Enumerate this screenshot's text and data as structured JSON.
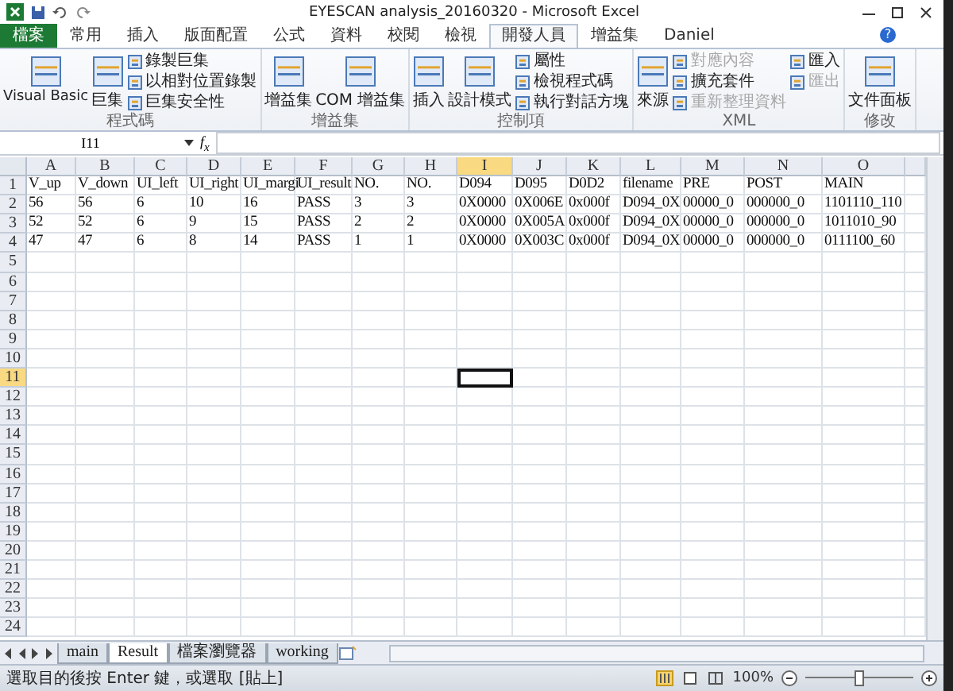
{
  "title_bar": {
    "title": "EYESCAN analysis_20160320 - Microsoft Excel"
  },
  "ribbon_tabs": [
    {
      "label": "檔案",
      "kind": "file",
      "selected": false
    },
    {
      "label": "常用",
      "kind": "tab",
      "selected": false
    },
    {
      "label": "插入",
      "kind": "tab",
      "selected": false
    },
    {
      "label": "版面配置",
      "kind": "tab",
      "selected": false
    },
    {
      "label": "公式",
      "kind": "tab",
      "selected": false
    },
    {
      "label": "資料",
      "kind": "tab",
      "selected": false
    },
    {
      "label": "校閱",
      "kind": "tab",
      "selected": false
    },
    {
      "label": "檢視",
      "kind": "tab",
      "selected": false
    },
    {
      "label": "開發人員",
      "kind": "tab",
      "selected": true
    },
    {
      "label": "增益集",
      "kind": "tab",
      "selected": false
    },
    {
      "label": "Daniel",
      "kind": "tab",
      "selected": false
    }
  ],
  "help_glyph": "?",
  "ribbon_groups": [
    {
      "label": "程式碼",
      "large": [
        "Visual Basic",
        "巨集"
      ],
      "small": [
        {
          "label": "錄製巨集",
          "disabled": false
        },
        {
          "label": "以相對位置錄製",
          "disabled": false
        },
        {
          "label": "巨集安全性",
          "disabled": false
        }
      ]
    },
    {
      "label": "增益集",
      "large": [
        "增益集",
        "COM 增益集"
      ]
    },
    {
      "label": "控制項",
      "large": [
        "插入",
        "設計模式"
      ],
      "small": [
        {
          "label": "屬性",
          "disabled": false
        },
        {
          "label": "檢視程式碼",
          "disabled": false
        },
        {
          "label": "執行對話方塊",
          "disabled": false
        }
      ]
    },
    {
      "label": "XML",
      "large": [
        "來源"
      ],
      "small": [
        {
          "label": "對應內容",
          "disabled": true
        },
        {
          "label": "擴充套件",
          "disabled": false
        },
        {
          "label": "重新整理資料",
          "disabled": true
        },
        {
          "label": "匯入",
          "disabled": false
        },
        {
          "label": "匯出",
          "disabled": true
        }
      ]
    },
    {
      "label": "修改",
      "large": [
        "文件面板"
      ]
    }
  ],
  "formula_bar": {
    "name_box": "I11",
    "function_label": "f$_{x}$"
  },
  "sheet": {
    "columns": [
      {
        "label": "A",
        "selected": false
      },
      {
        "label": "B",
        "selected": false
      },
      {
        "label": "C",
        "selected": false
      },
      {
        "label": "D",
        "selected": false
      },
      {
        "label": "E",
        "selected": false
      },
      {
        "label": "F",
        "selected": false
      },
      {
        "label": "G",
        "selected": false
      },
      {
        "label": "H",
        "selected": false
      },
      {
        "label": "I",
        "selected": true
      },
      {
        "label": "J",
        "selected": false
      },
      {
        "label": "K",
        "selected": false
      },
      {
        "label": "L",
        "selected": false
      },
      {
        "label": "M",
        "selected": false
      },
      {
        "label": "N",
        "selected": false
      },
      {
        "label": "O",
        "selected": false
      }
    ],
    "row_numbers": [
      {
        "label": "1",
        "selected": false
      },
      {
        "label": "2",
        "selected": false
      },
      {
        "label": "3",
        "selected": false
      },
      {
        "label": "4",
        "selected": false
      },
      {
        "label": "5",
        "selected": false
      },
      {
        "label": "6",
        "selected": false
      },
      {
        "label": "7",
        "selected": false
      },
      {
        "label": "8",
        "selected": false
      },
      {
        "label": "9",
        "selected": false
      },
      {
        "label": "10",
        "selected": false
      },
      {
        "label": "11",
        "selected": true
      },
      {
        "label": "12",
        "selected": false
      },
      {
        "label": "13",
        "selected": false
      },
      {
        "label": "14",
        "selected": false
      },
      {
        "label": "15",
        "selected": false
      },
      {
        "label": "16",
        "selected": false
      },
      {
        "label": "17",
        "selected": false
      },
      {
        "label": "18",
        "selected": false
      },
      {
        "label": "19",
        "selected": false
      },
      {
        "label": "20",
        "selected": false
      },
      {
        "label": "21",
        "selected": false
      },
      {
        "label": "22",
        "selected": false
      },
      {
        "label": "23",
        "selected": false
      },
      {
        "label": "24",
        "selected": false
      }
    ],
    "rows": [
      [
        "V_up",
        "V_down",
        "UI_left",
        "UI_right",
        "UI_margi",
        "UI_result",
        "NO.",
        "NO.",
        "D094",
        "D095",
        "D0D2",
        "filename",
        "PRE",
        "POST",
        "MAIN"
      ],
      [
        "56",
        "56",
        "6",
        "10",
        "16",
        "PASS",
        "3",
        "3",
        "0X0000",
        "0X006E",
        "0x000f",
        "D094_0X",
        "00000_0",
        "000000_0",
        "1101110_110"
      ],
      [
        "52",
        "52",
        "6",
        "9",
        "15",
        "PASS",
        "2",
        "2",
        "0X0000",
        "0X005A",
        "0x000f",
        "D094_0X",
        "00000_0",
        "000000_0",
        "1011010_90"
      ],
      [
        "47",
        "47",
        "6",
        "8",
        "14",
        "PASS",
        "1",
        "1",
        "0X0000",
        "0X003C",
        "0x000f",
        "D094_0X",
        "00000_0",
        "000000_0",
        "0111100_60"
      ]
    ]
  },
  "sheet_tabs": [
    {
      "label": "main",
      "selected": false
    },
    {
      "label": "Result",
      "selected": true
    },
    {
      "label": "檔案瀏覽器",
      "selected": false
    },
    {
      "label": "working",
      "selected": false
    }
  ],
  "status_bar": {
    "message": "選取目的後按 Enter 鍵，或選取 [貼上]",
    "zoom": "100%",
    "zoom_slider": {
      "level": 0.5
    }
  }
}
